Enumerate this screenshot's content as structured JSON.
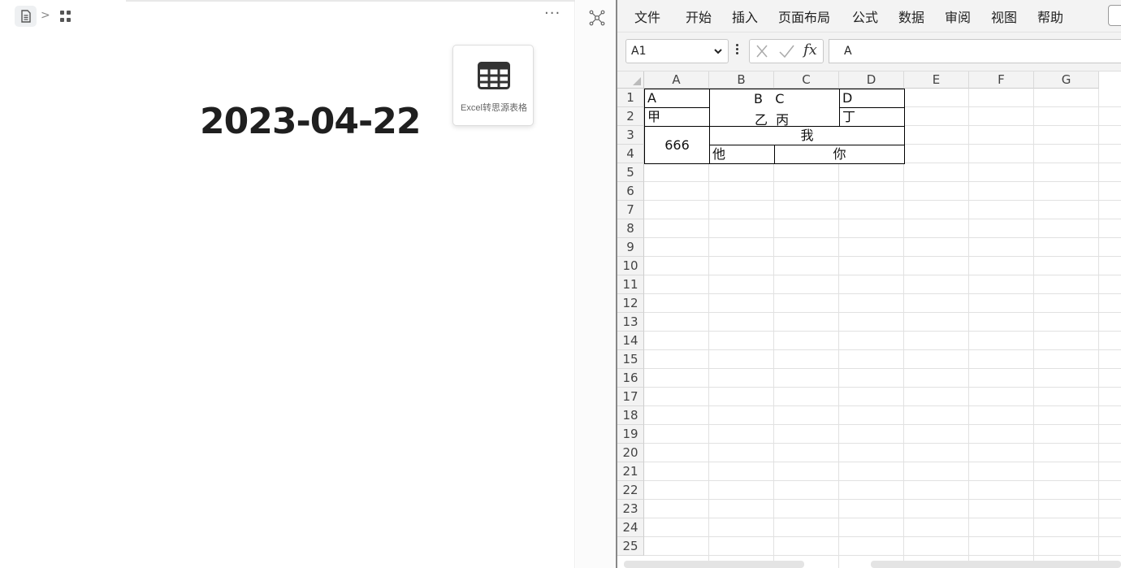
{
  "note": {
    "title": "2023-04-22",
    "more_label": "···",
    "widget_label": "Excel转思源表格"
  },
  "ribbon": {
    "menu": [
      "文件",
      "开始",
      "插入",
      "页面布局",
      "公式",
      "数据",
      "审阅",
      "视图",
      "帮助"
    ]
  },
  "formula_bar": {
    "name_box": "A1",
    "fx_label": "fx",
    "value": "A"
  },
  "sheet": {
    "columns": [
      "A",
      "B",
      "C",
      "D",
      "E",
      "F",
      "G"
    ],
    "rows": [
      "1",
      "2",
      "3",
      "4",
      "5",
      "6",
      "7",
      "8",
      "9",
      "10",
      "11",
      "12",
      "13",
      "14",
      "15",
      "16",
      "17",
      "18",
      "19",
      "20",
      "21",
      "22",
      "23",
      "24",
      "25"
    ],
    "cells": {
      "a1": "A",
      "bc12": "B   C\n乙  丙",
      "bc12_top": "B   C",
      "bc12_bottom": "乙  丙",
      "d1": "D",
      "a2": "甲",
      "d2": "丁",
      "a34": "666",
      "bd3": "我",
      "b4": "他",
      "cd4": "你"
    }
  },
  "colors": {
    "accent": "#1f1f1f",
    "grid": "#e1e1e1",
    "header_bg": "#f3f3f3"
  }
}
